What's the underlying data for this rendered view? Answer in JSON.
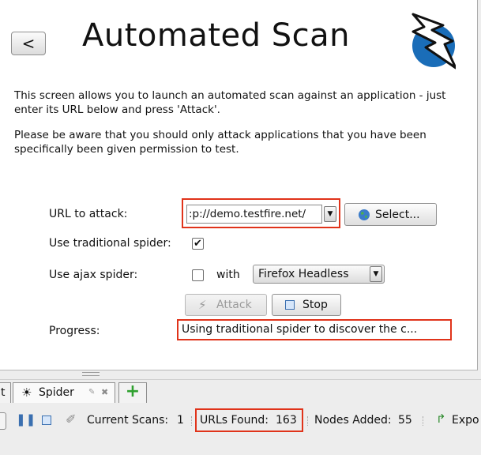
{
  "header": {
    "back_label": "<",
    "title": "Automated Scan"
  },
  "intro": {
    "paragraph1": "This screen allows you to launch an automated scan against  an application - just enter its URL below and press 'Attack'.",
    "paragraph2": "Please be aware that you should only attack applications that you have been specifically been given permission to test."
  },
  "form": {
    "url_label": "URL to attack:",
    "url_value": ":p://demo.testfire.net/",
    "select_button": "Select...",
    "traditional_label": "Use traditional spider:",
    "traditional_checked": true,
    "ajax_label": "Use ajax spider:",
    "ajax_checked": false,
    "with_label": "with",
    "browser_value": "Firefox Headless",
    "attack_button": "Attack",
    "stop_button": "Stop",
    "progress_label": "Progress:",
    "progress_value": "Using traditional spider to discover the c..."
  },
  "tabs": {
    "partial_tab": "t",
    "spider_tab": "Spider",
    "add_tab": "+"
  },
  "status": {
    "current_scans_label": "Current Scans:",
    "current_scans_value": "1",
    "urls_found_label": "URLs Found:",
    "urls_found_value": "163",
    "nodes_added_label": "Nodes Added:",
    "nodes_added_value": "55",
    "export_label": "Expo"
  },
  "colors": {
    "highlight": "#e0331a",
    "logo_blue": "#1a6db8",
    "add_green": "#2ea02e"
  },
  "icons": [
    "zap-logo-icon",
    "globe-icon",
    "checkbox-checked-icon",
    "lightning-icon",
    "stop-square-icon",
    "spider-icon",
    "pin-icon",
    "close-icon",
    "plus-icon",
    "pause-icon",
    "stop-icon",
    "broom-icon",
    "export-arrow-icon",
    "dropdown-arrow-icon"
  ]
}
